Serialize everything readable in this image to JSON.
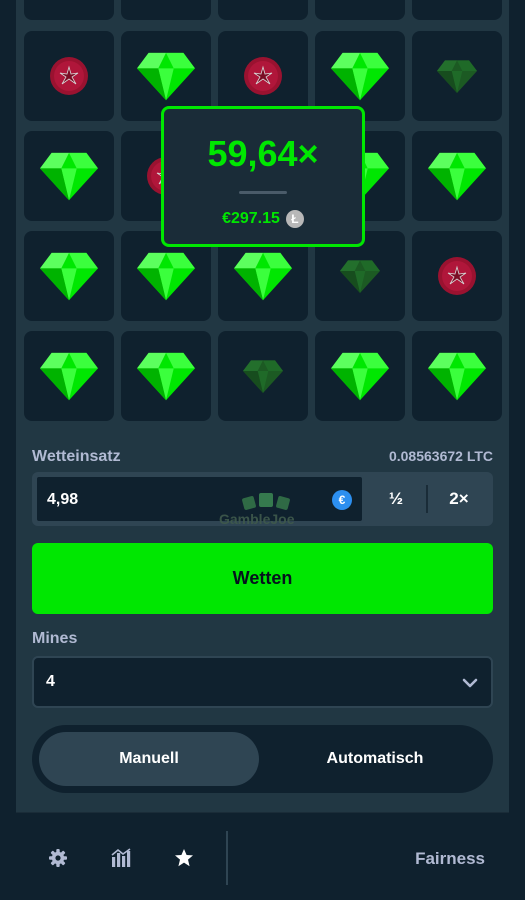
{
  "board": {
    "rows": [
      [
        "mine",
        "gem",
        "mine",
        "gem",
        "gem-dim"
      ],
      [
        "gem",
        "mine",
        "hidden",
        "gem",
        "gem"
      ],
      [
        "gem",
        "gem",
        "gem",
        "gem-dim",
        "mine"
      ],
      [
        "gem",
        "gem",
        "gem-dim",
        "gem",
        "gem"
      ]
    ]
  },
  "payout": {
    "multiplier": "59,64×",
    "amount": "€297.15",
    "coin_symbol": "Ł"
  },
  "bet": {
    "label": "Wetteinsatz",
    "balance": "0.08563672 LTC",
    "value": "4,98",
    "currency_symbol": "€",
    "half_label": "½",
    "double_label": "2×",
    "watermark": "GambleJoe"
  },
  "wetten_label": "Wetten",
  "mines": {
    "label": "Mines",
    "value": "4"
  },
  "mode": {
    "manual": "Manuell",
    "auto": "Automatisch"
  },
  "footer": {
    "fairness": "Fairness"
  },
  "colors": {
    "accent": "#00e701",
    "bg": "#0f212e",
    "panel": "#213743",
    "mine": "#b0163a"
  }
}
